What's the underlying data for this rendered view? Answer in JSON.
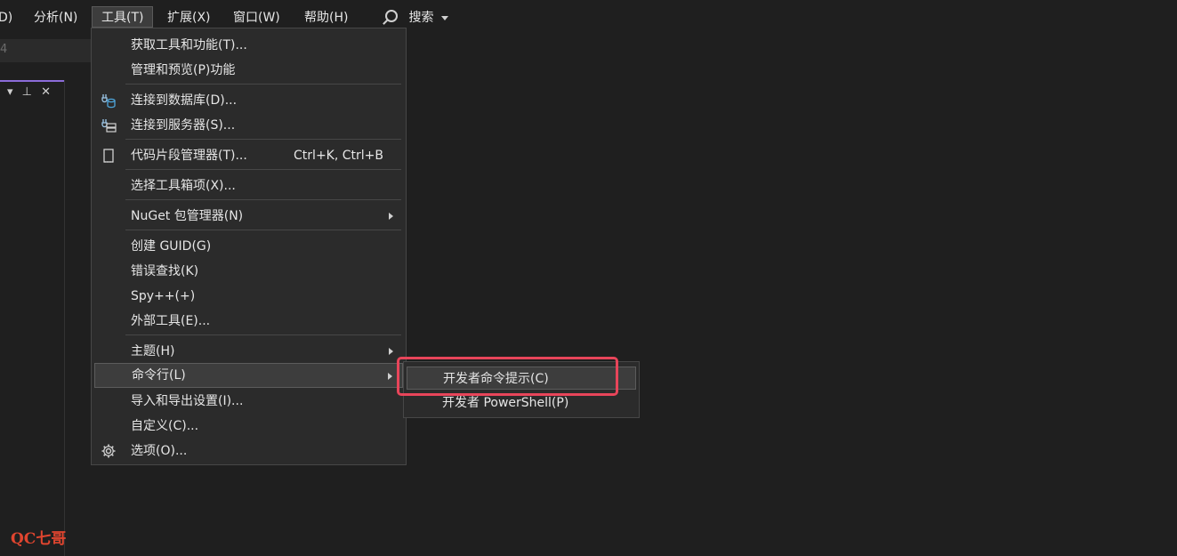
{
  "menubar": {
    "partial_left": "D)",
    "items": [
      "分析(N)",
      "工具(T)",
      "扩展(X)",
      "窗口(W)",
      "帮助(H)"
    ],
    "search_label": "搜索"
  },
  "toolbar": {
    "partial_text": "4"
  },
  "panel": {
    "icons": [
      "▾",
      "⊥",
      "✕"
    ]
  },
  "tools_menu": {
    "items": [
      {
        "label": "获取工具和功能(T)..."
      },
      {
        "label": "管理和预览(P)功能"
      },
      {
        "label": "连接到数据库(D)..."
      },
      {
        "label": "连接到服务器(S)..."
      },
      {
        "label": "代码片段管理器(T)...",
        "shortcut": "Ctrl+K, Ctrl+B"
      },
      {
        "label": "选择工具箱项(X)..."
      },
      {
        "label": "NuGet 包管理器(N)"
      },
      {
        "label": "创建 GUID(G)"
      },
      {
        "label": "错误查找(K)"
      },
      {
        "label": "Spy++(+)"
      },
      {
        "label": "外部工具(E)..."
      },
      {
        "label": "主题(H)"
      },
      {
        "label": "命令行(L)"
      },
      {
        "label": "导入和导出设置(I)..."
      },
      {
        "label": "自定义(C)..."
      },
      {
        "label": "选项(O)..."
      }
    ]
  },
  "command_line_submenu": {
    "items": [
      {
        "label": "开发者命令提示(C)"
      },
      {
        "label": "开发者 PowerShell(P)"
      }
    ]
  },
  "watermark": "QC七哥",
  "colors": {
    "highlight_box": "#e8455a",
    "accent": "#8c6cd9"
  }
}
